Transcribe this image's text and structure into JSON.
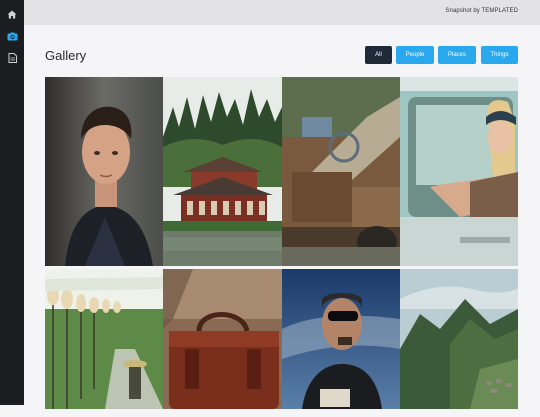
{
  "brand": "Snapshot by TEMPLATED",
  "page_title": "Gallery",
  "filters": [
    {
      "label": "All",
      "active": true
    },
    {
      "label": "People",
      "active": false
    },
    {
      "label": "Places",
      "active": false
    },
    {
      "label": "Things",
      "active": false
    }
  ],
  "sidebar_icons": [
    "home-icon",
    "camera-icon",
    "document-icon"
  ],
  "colors": {
    "sidebar_bg": "#1b1d20",
    "topbar_bg": "#e3e3e5",
    "accent": "#29a8ee",
    "active_filter": "#1f2a38",
    "active_icon": "#29a8ee"
  },
  "photos": [
    {
      "subject": "portrait-man"
    },
    {
      "subject": "japanese-temple"
    },
    {
      "subject": "old-truck"
    },
    {
      "subject": "woman-in-car"
    },
    {
      "subject": "lanterns-path"
    },
    {
      "subject": "leather-bag"
    },
    {
      "subject": "man-smoking"
    },
    {
      "subject": "mountain-ruins"
    }
  ]
}
